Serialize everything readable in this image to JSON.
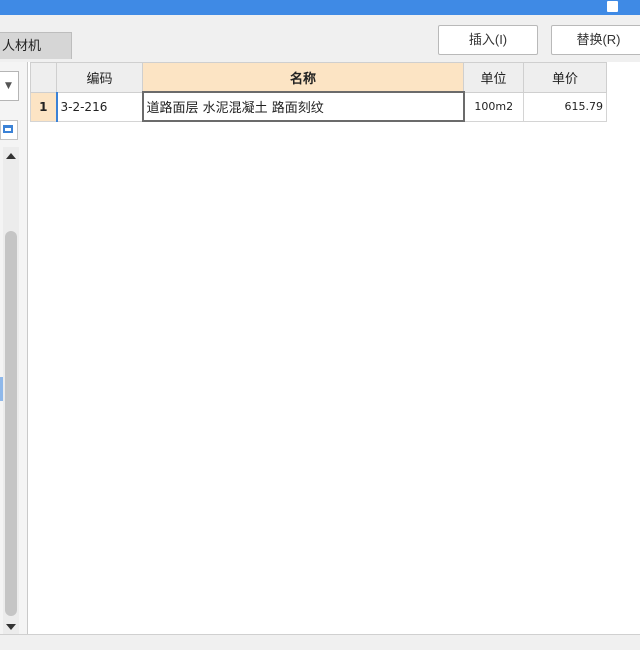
{
  "toolbar": {
    "tab_label": "人材机",
    "insert_label": "插入(I)",
    "replace_label": "替换(R)"
  },
  "left_panel": {
    "dropdown_icon": "chevron-down-icon",
    "tool_icon": "print-icon"
  },
  "grid": {
    "columns": [
      "编码",
      "名称",
      "单位",
      "单价"
    ],
    "rows": [
      {
        "index": "1",
        "code": "3-2-216",
        "name": "道路面层 水泥混凝土 路面刻纹",
        "unit": "100m2",
        "price": "615.79"
      }
    ]
  },
  "colors": {
    "titlebar": "#3f8ae5",
    "header_highlight": "#fce4c4",
    "selection_border": "#3b82d6"
  }
}
